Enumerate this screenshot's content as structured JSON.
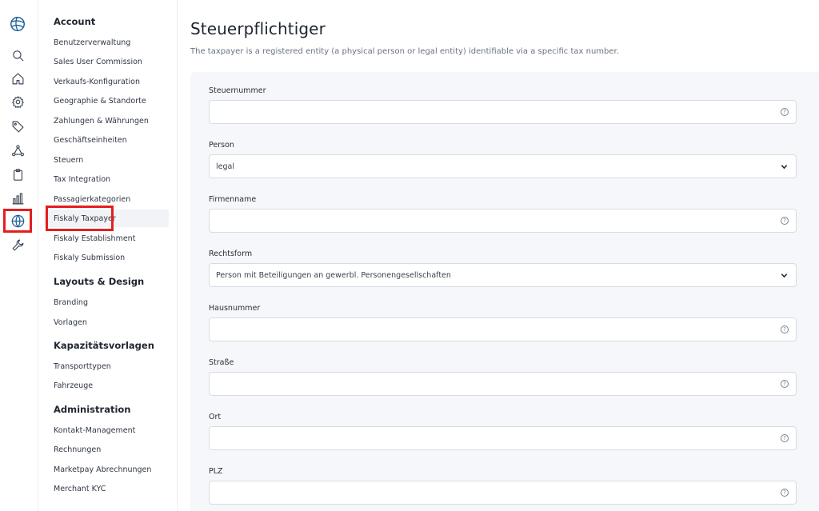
{
  "sidebar": {
    "groups": [
      {
        "title": "Account",
        "items": [
          {
            "label": "Benutzerverwaltung"
          },
          {
            "label": "Sales User Commission"
          },
          {
            "label": "Verkaufs-Konfiguration"
          },
          {
            "label": "Geographie & Standorte"
          },
          {
            "label": "Zahlungen & Währungen"
          },
          {
            "label": "Geschäftseinheiten"
          },
          {
            "label": "Steuern"
          },
          {
            "label": "Tax Integration"
          },
          {
            "label": "Passagierkategorien"
          },
          {
            "label": "Fiskaly Taxpayer"
          },
          {
            "label": "Fiskaly Establishment"
          },
          {
            "label": "Fiskaly Submission"
          }
        ]
      },
      {
        "title": "Layouts & Design",
        "items": [
          {
            "label": "Branding"
          },
          {
            "label": "Vorlagen"
          }
        ]
      },
      {
        "title": "Kapazitätsvorlagen",
        "items": [
          {
            "label": "Transporttypen"
          },
          {
            "label": "Fahrzeuge"
          }
        ]
      },
      {
        "title": "Administration",
        "items": [
          {
            "label": "Kontakt-Management"
          },
          {
            "label": "Rechnungen"
          },
          {
            "label": "Marketpay Abrechnungen"
          },
          {
            "label": "Merchant KYC"
          }
        ]
      }
    ]
  },
  "page": {
    "title": "Steuerpflichtiger",
    "subtitle": "The taxpayer is a registered entity (a physical person or legal entity) identifiable via a specific tax number."
  },
  "form": {
    "fields": [
      {
        "label": "Steuernummer",
        "value": ""
      },
      {
        "label": "Person",
        "value": "legal"
      },
      {
        "label": "Firmenname",
        "value": ""
      },
      {
        "label": "Rechtsform",
        "value": "Person mit Beteiligungen an gewerbl. Personengesellschaften"
      },
      {
        "label": "Hausnummer",
        "value": ""
      },
      {
        "label": "Straße",
        "value": ""
      },
      {
        "label": "Ort",
        "value": ""
      },
      {
        "label": "PLZ",
        "value": ""
      }
    ],
    "help_glyph": "?"
  },
  "colors": {
    "highlight": "#e41e1e",
    "accent": "#1f5e99",
    "card_bg": "#f5f7fa"
  },
  "rail_icons": [
    "logo-icon",
    "search-icon",
    "home-icon",
    "gear-icon",
    "tag-icon",
    "network-icon",
    "clipboard-icon",
    "bar-chart-icon",
    "globe-icon",
    "wrench-icon"
  ]
}
